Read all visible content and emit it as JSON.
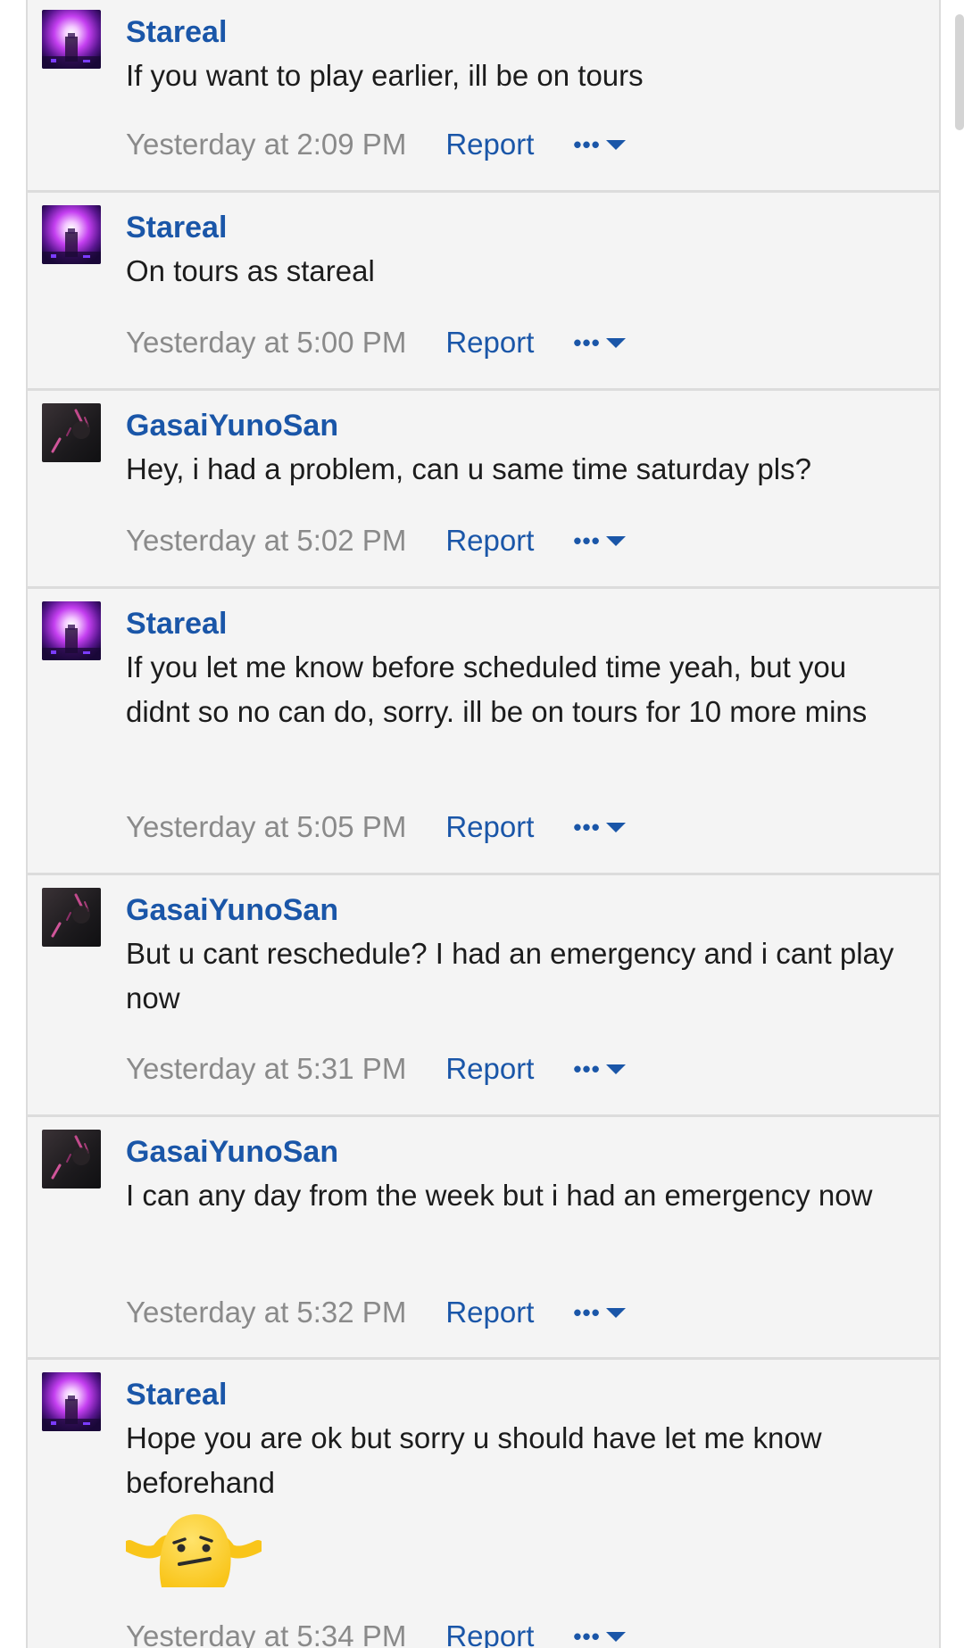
{
  "colors": {
    "link": "#1a56a8",
    "text": "#1c1c1c",
    "muted": "#8a8a8a",
    "thread_bg": "#f4f4f4",
    "divider": "#dcdcdc"
  },
  "action_labels": {
    "report": "Report",
    "more": "•••"
  },
  "messages": [
    {
      "author": "Stareal",
      "avatar": "stareal-avatar",
      "text": "If you want to play earlier, ill be on tours",
      "time": "Yesterday at 2:09 PM"
    },
    {
      "author": "Stareal",
      "avatar": "stareal-avatar",
      "text": "On tours as stareal",
      "time": "Yesterday at 5:00 PM"
    },
    {
      "author": "GasaiYunoSan",
      "avatar": "gasaiyunosan-avatar",
      "text": "Hey, i had a problem, can u same time saturday pls?",
      "time": "Yesterday at 5:02 PM"
    },
    {
      "author": "Stareal",
      "avatar": "stareal-avatar",
      "text": "If you let me know before scheduled time yeah, but you didnt so no can do, sorry. ill be on tours for 10 more mins",
      "time": "Yesterday at 5:05 PM"
    },
    {
      "author": "GasaiYunoSan",
      "avatar": "gasaiyunosan-avatar",
      "text": "But u cant reschedule? I had an emergency and i cant play now",
      "time": "Yesterday at 5:31 PM"
    },
    {
      "author": "GasaiYunoSan",
      "avatar": "gasaiyunosan-avatar",
      "text": "I can any day from the week but i had an emergency now",
      "time": "Yesterday at 5:32 PM"
    },
    {
      "author": "Stareal",
      "avatar": "stareal-avatar",
      "text": "Hope you are ok but sorry u should have let me know beforehand",
      "emoji": "shrug-blob-emoji",
      "time": "Yesterday at 5:34 PM"
    }
  ]
}
